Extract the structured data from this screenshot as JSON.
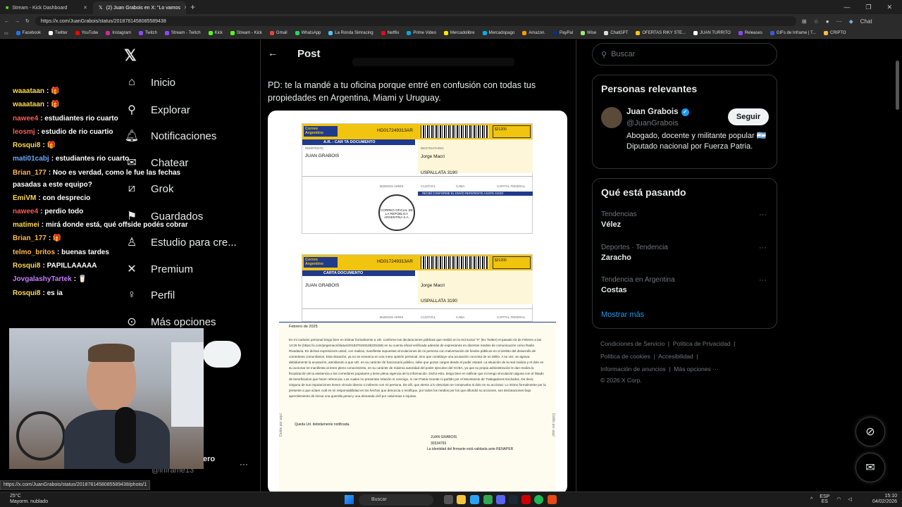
{
  "browser": {
    "tabs": [
      {
        "title": "Stream - Kick Dashboard",
        "active": false
      },
      {
        "title": "(2) Juan Grabois en X: \"Lo vamos",
        "active": true
      }
    ],
    "url": "https://x.com/JuanGrabois/status/2018781458085589438",
    "bookmarks": [
      "Facebook",
      "Twitter",
      "YouTube",
      "Instagram",
      "Twitch",
      "Stream - Twitch",
      "Kick",
      "Stream - Kick",
      "Gmail",
      "WhatsApp",
      "La Ronda Simracing",
      "Netflix",
      "Prime Video",
      "Mercadolibre",
      "Mercadopago",
      "Amazon.",
      "PayPal",
      "Wise",
      "ChatGPT",
      "OFERTAS RIKY STE...",
      "JUAN TURRITO",
      "Releases",
      "GIFs de Inframe | T...",
      "CRIPTO"
    ],
    "hover_url": "https://x.com/JuanGrabois/status/2018781458085589438/photo/1",
    "chat_ext": "Chat"
  },
  "nav": {
    "items": [
      "Inicio",
      "Explorar",
      "Notificaciones",
      "Chatear",
      "Grok",
      "Guardados",
      "Estudio para cre...",
      "Premium",
      "Perfil",
      "Más opciones"
    ],
    "profile_name": "ero",
    "profile_handle": "@inframe13"
  },
  "post": {
    "header": "Post",
    "text": "PD: te la mandé a tu oficina porque entré en confusión con todas tus propiedades en Argentina, Miami y Uruguay.",
    "card1": {
      "company": "Correo Argentino",
      "code": "HD017249313AR",
      "title": "A.R. - CAR TA DOCUMENTO",
      "price": "$21200",
      "sender_label": "REMITENTE",
      "sender": "JUAN GRABOIS",
      "dest_label": "DESTINATARIO",
      "dest": "Jorge Macri",
      "address": "USPALLATA 3190",
      "province": "BUENOS AIRES",
      "cp": "C1437JCL",
      "locality": "CABA",
      "province2": "CAPITAL FEDERAL",
      "received": "RECIBÍ CONFORME EL ENVÍO REFERENTE A ESTE AVISO",
      "seal": "CORREO OFICIAL DE LA REPÚBLICA ARGENTINA S.A."
    },
    "card2": {
      "company": "Correo Argentino",
      "code": "HD017249313AR",
      "title": "CARTA DOCUMENTO",
      "price": "$21200",
      "sender": "JUAN GRABOIS",
      "dest": "Jorge Macri",
      "address": "USPALLATA 3190",
      "province": "BUENOS AIRES",
      "cp": "C1437JCL",
      "locality": "CABA",
      "province2": "CAPITAL FEDERAL"
    },
    "letter": {
      "date": "Febrero de 2025",
      "body": "En mi carácter personal tengo bien en intimar formalmente a UD. conforme las declaraciones públicas que realizó en la red social \"X\" (Ex Twitter) el pasado 02 de Febrero a las 14:26 hs (https://x.com/jorgemacri/status/2018376193188225159) en su cuenta oficial verificada además de expresiones en diversos medios de comunicación como Radio Rivadavia. En dichas expresiones usted, con malicia, manifiesta supuestas vinculaciones de mi persona con malversación de fondos públicos en el ámbito del desarrollo de comedores comunitarios. Esta situación, ya no se enmarca en una mera opinión personal, sino que constituye una acusación concreta de un delito. A su vez, se agrava debidamente la acusación, atendiendo a que UD. en su carácter de funcionario público, sabe que gozan cargos desde el poder estatal. La situación de la real malicia y el dolo en su accionar se manifiesta al tener pleno conocimiento, en su carácter de máxima autoridad del poder ejecutivo del GCBA, ya que su propia administración le dan realiza la fiscalización de la asistencia a los comedores populares y tiene plena vigencia de la información. Dicho esto, tengo bien en ratificar que mi tengo vinculación alguna con el listado de beneficiarios que hacer referencia. Los cuales no presentan relación ni conmigo, ni con Patria Grande ni partido por el Movimiento de Trabajadores Excluidos. De decir, ninguna de sus imputaciones tienen vínculo directo o indirecto con mi persona. De allí, que atento a lo descripto se comprueba el dolo en su accionar. Lo intimo formalmente por la presente a que aclare cuál es mi responsabilidad en los hechos que denuncia o rectifique, por todos los medios por los que difundió su acciones, sus declaraciones bajo apercibimiento de iniciar una querella penal y una demanda civil por calumnias e injurias.",
      "closing": "Queda Ud. debidamente notificada.",
      "signature": "JUAN GRABOIS",
      "dni": "30334765",
      "footer": "La identidad del firmante está validada ante RENAPER",
      "side_left": "Doble por aquí",
      "side_right": "Doble por aquí"
    }
  },
  "sidebar": {
    "search_placeholder": "Buscar",
    "relevant_title": "Personas relevantes",
    "person": {
      "name": "Juan Grabois",
      "handle": "@JuanGrabois",
      "bio": "Abogado, docente y militante popular 🇦🇷 Diputado nacional por Fuerza Patria.",
      "follow": "Seguir"
    },
    "trends_title": "Qué está pasando",
    "trends": [
      {
        "category": "Tendencias",
        "name": "Vélez"
      },
      {
        "category": "Deportes · Tendencia",
        "name": "Zaracho"
      },
      {
        "category": "Tendencia en Argentina",
        "name": "Costas"
      }
    ],
    "show_more": "Mostrar más",
    "footer_links": [
      "Condiciones de Servicio",
      "Política de Privacidad",
      "Política de cookies",
      "Accesibilidad",
      "Información de anuncios",
      "Más opciones ···",
      "© 2026 X Corp."
    ]
  },
  "chat": [
    {
      "user": "waaataan",
      "msg": "🎁",
      "color": "#ffd94d"
    },
    {
      "user": "waaataan",
      "msg": "🎁",
      "color": "#ffd94d"
    },
    {
      "user": "nawee4",
      "msg": "estudiantes rio cuarto",
      "color": "#ff5a5a"
    },
    {
      "user": "leosmj",
      "msg": "estudio de rio cuartio",
      "color": "#ff5a5a"
    },
    {
      "user": "Rosqui8",
      "msg": "🎁",
      "color": "#ffd94d"
    },
    {
      "user": "mati01cabj",
      "msg": "estudiantes rio cuarto",
      "color": "#6aa8ff"
    },
    {
      "user": "Brian_177",
      "msg": "Noo es verdad, como le fue las fechas pasadas a este equipo?",
      "color": "#ffb84d"
    },
    {
      "user": "EmiVM",
      "msg": "con desprecio",
      "color": "#ffd94d"
    },
    {
      "user": "nawee4",
      "msg": "perdio todo",
      "color": "#ff5a5a"
    },
    {
      "user": "matimei",
      "msg": "mirá donde está, qué offside podés cobrar",
      "color": "#ffd94d"
    },
    {
      "user": "Brian_177",
      "msg": "🎁",
      "color": "#ffb84d"
    },
    {
      "user": "telmo_britos",
      "msg": "buenas tardes",
      "color": "#ffb84d"
    },
    {
      "user": "Rosqui8",
      "msg": "PAPILLAAAAA",
      "color": "#ffd94d"
    },
    {
      "user": "JovgalashyTartek",
      "msg": "🥛",
      "color": "#c77dff"
    },
    {
      "user": "Rosqui8",
      "msg": "es ia",
      "color": "#ffd94d"
    }
  ],
  "taskbar": {
    "temp": "25°C",
    "weather": "Mayorm. nublado",
    "search": "Buscar",
    "lang1": "ESP",
    "lang2": "ES",
    "time": "15:10",
    "date": "04/02/2026"
  }
}
